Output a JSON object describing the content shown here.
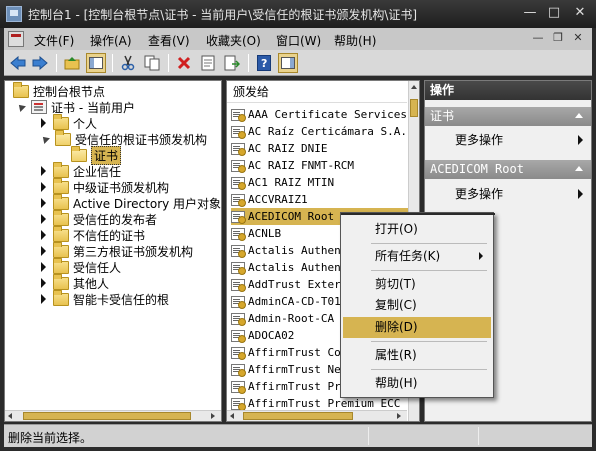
{
  "window": {
    "title": "控制台1 - [控制台根节点\\证书 - 当前用户\\受信任的根证书颁发机构\\证书]",
    "buttons": {
      "minimize": "—",
      "maximize": "□",
      "close": "✕"
    }
  },
  "menubar": {
    "items": [
      "文件(F)",
      "操作(A)",
      "查看(V)",
      "收藏夹(O)",
      "窗口(W)",
      "帮助(H)"
    ],
    "child_buttons": {
      "minimize": "—",
      "restore": "❐",
      "close": "✕"
    }
  },
  "toolbar": {
    "buttons": [
      "back-icon",
      "forward-icon",
      "up-icon",
      "show-hide-tree-icon",
      "cut-icon",
      "copy-icon",
      "delete-icon",
      "properties-icon",
      "export-list-icon",
      "help-icon",
      "show-hide-action-pane-icon"
    ]
  },
  "tree": {
    "root": "控制台根节点",
    "certs_user": "证书 - 当前用户",
    "items": [
      {
        "label": "个人"
      },
      {
        "label": "受信任的根证书颁发机构"
      },
      {
        "label": "证书"
      },
      {
        "label": "企业信任"
      },
      {
        "label": "中级证书颁发机构"
      },
      {
        "label": "Active Directory 用户对象"
      },
      {
        "label": "受信任的发布者"
      },
      {
        "label": "不信任的证书"
      },
      {
        "label": "第三方根证书颁发机构"
      },
      {
        "label": "受信任人"
      },
      {
        "label": "其他人"
      },
      {
        "label": "智能卡受信任的根"
      }
    ]
  },
  "list": {
    "column_header": "颁发给",
    "rows": [
      "AAA Certificate Services",
      "AC Raíz Certicámara S.A.",
      "AC RAIZ DNIE",
      "AC RAIZ FNMT-RCM",
      "AC1 RAIZ MTIN",
      "ACCVRAIZ1",
      "ACEDICOM Root",
      "ACNLB",
      "Actalis Authentication Root CA",
      "Actalis Authentication CA G1",
      "AddTrust External CA Root",
      "AdminCA-CD-T01",
      "Admin-Root-CA",
      "ADOCA02",
      "AffirmTrust Commercial",
      "AffirmTrust Networking",
      "AffirmTrust Premium",
      "AffirmTrust Premium ECC"
    ],
    "selected_index": 6
  },
  "actions": {
    "header": "操作",
    "section1": {
      "title": "证书",
      "more": "更多操作"
    },
    "section2": {
      "title": "ACEDICOM Root",
      "more": "更多操作"
    }
  },
  "context_menu": {
    "items": [
      {
        "label": "打开(O)"
      },
      {
        "label": "所有任务(K)",
        "submenu": true
      },
      {
        "label": "剪切(T)"
      },
      {
        "label": "复制(C)"
      },
      {
        "label": "删除(D)",
        "highlighted": true
      },
      {
        "label": "属性(R)"
      },
      {
        "label": "帮助(H)"
      }
    ]
  },
  "status": {
    "text": "删除当前选择。"
  },
  "colors": {
    "selection": "#d6b451",
    "titlebar": "#2b2b2b",
    "action_header": "#3c3c3c"
  }
}
